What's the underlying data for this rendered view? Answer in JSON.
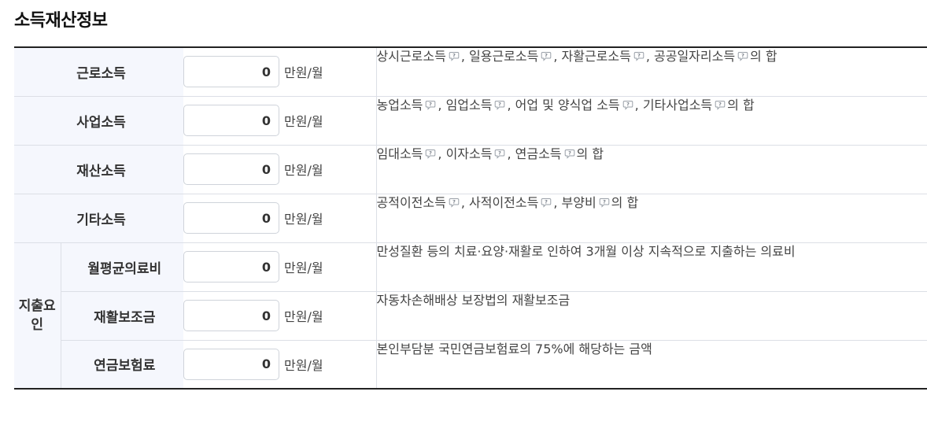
{
  "section": {
    "title": "소득재산정보"
  },
  "unit_label": "만원/월",
  "rows": [
    {
      "label": "근로소득",
      "value": "0",
      "desc": {
        "items": [
          "상시근로소득",
          "일용근로소득",
          "자활근로소득",
          "공공일자리소득"
        ],
        "suffix": "의 합"
      }
    },
    {
      "label": "사업소득",
      "value": "0",
      "desc": {
        "items": [
          "농업소득",
          "임업소득",
          "어업 및 양식업 소득",
          "기타사업소득"
        ],
        "suffix": "의 합"
      }
    },
    {
      "label": "재산소득",
      "value": "0",
      "desc": {
        "items": [
          "임대소득",
          "이자소득",
          "연금소득"
        ],
        "suffix": "의 합"
      }
    },
    {
      "label": "기타소득",
      "value": "0",
      "desc": {
        "items": [
          "공적이전소득",
          "사적이전소득",
          "부양비"
        ],
        "suffix": "의 합"
      }
    }
  ],
  "expense_group": {
    "label": "지출요인",
    "rows": [
      {
        "label": "월평균의료비",
        "value": "0",
        "desc": "만성질환 등의 치료·요양·재활로 인하여 3개월 이상 지속적으로 지출하는 의료비"
      },
      {
        "label": "재활보조금",
        "value": "0",
        "desc": "자동차손해배상 보장법의 재활보조금"
      },
      {
        "label": "연금보험료",
        "value": "0",
        "desc": "본인부담분 국민연금보험료의 75%에 해당하는 금액"
      }
    ]
  },
  "icons": {
    "help": "help-bubble-icon"
  },
  "colors": {
    "label_bg": "#f5f7fd",
    "border": "#dcdfe6",
    "rule": "#222222"
  }
}
